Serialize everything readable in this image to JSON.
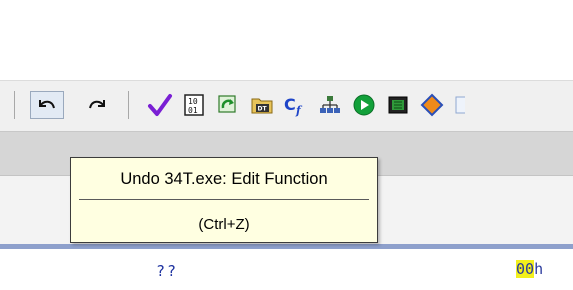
{
  "toolbar": {
    "buttons": [
      {
        "name": "undo-button",
        "icon": "undo-arrow-icon",
        "pressed": true
      },
      {
        "name": "redo-button",
        "icon": "redo-arrow-icon",
        "pressed": false
      },
      {
        "name": "check-button",
        "icon": "checkmark-icon"
      },
      {
        "name": "binary-button",
        "icon": "binary-01-icon"
      },
      {
        "name": "refresh-button",
        "icon": "green-refresh-icon"
      },
      {
        "name": "datatype-button",
        "icon": "dt-folder-icon"
      },
      {
        "name": "function-button",
        "icon": "cf-function-icon"
      },
      {
        "name": "hierarchy-button",
        "icon": "tree-hierarchy-icon"
      },
      {
        "name": "run-button",
        "icon": "green-play-icon"
      },
      {
        "name": "chip-button",
        "icon": "memory-chip-icon"
      },
      {
        "name": "diamond-button",
        "icon": "orange-diamond-icon"
      }
    ]
  },
  "tooltip": {
    "title": "Undo 34T.exe: Edit Function",
    "shortcut": "(Ctrl+Z)"
  },
  "listing": {
    "unknown_value": "??",
    "hex_highlight": "00",
    "hex_suffix": "h"
  },
  "colors": {
    "tooltip_bg": "#ffffe1",
    "highlight": "#f2ef1d",
    "accent_blue": "#8ea0cc"
  }
}
